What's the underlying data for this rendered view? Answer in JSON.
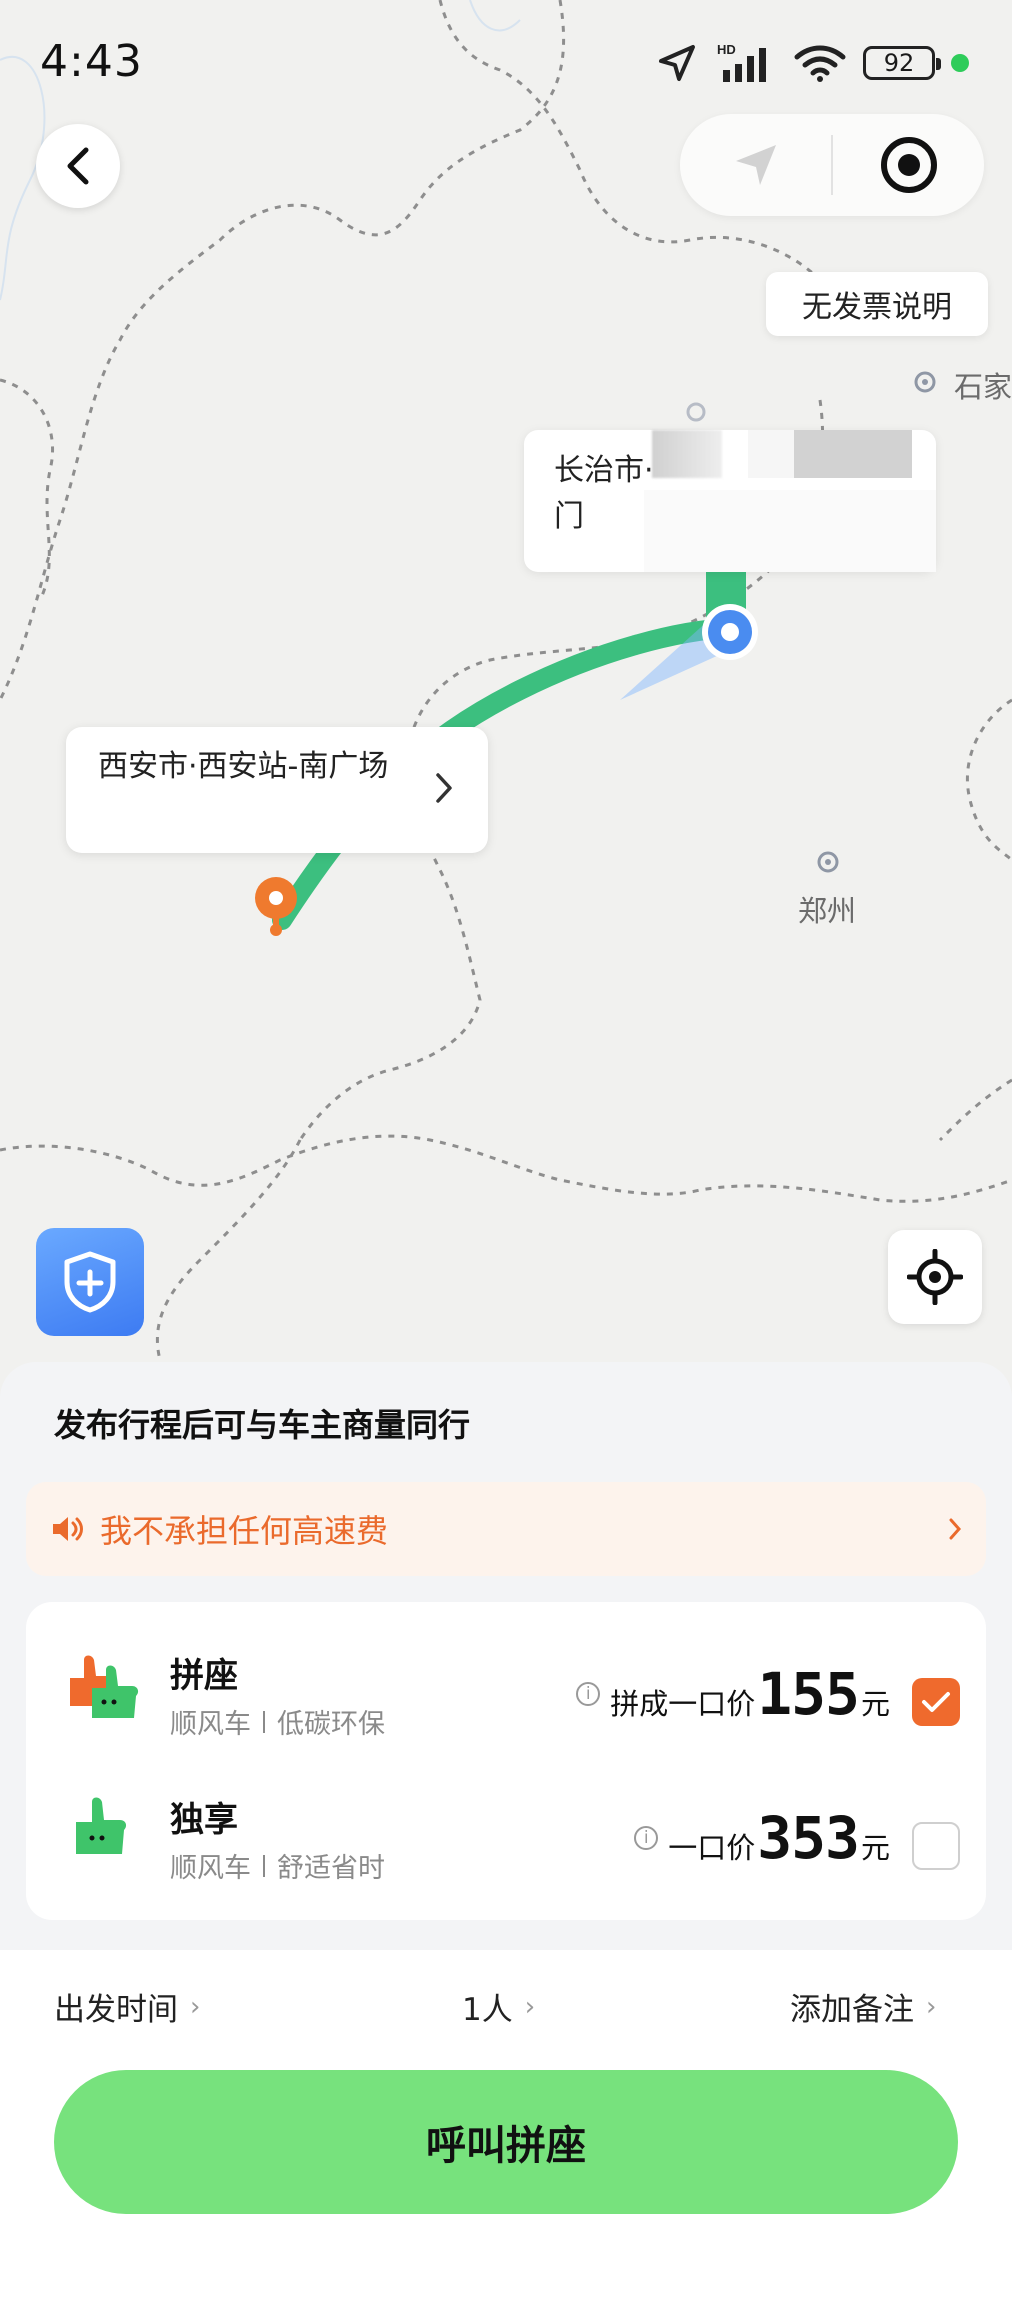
{
  "status_bar": {
    "time": "4:43",
    "battery": "92",
    "network": "HD"
  },
  "map": {
    "invoice_button": "无发票说明",
    "city_labels": [
      "石家",
      "郑州"
    ],
    "destination_label": {
      "line1": "长治市·",
      "line2": "门"
    },
    "origin_label": {
      "text": "西安市·西安站-南广场"
    }
  },
  "sheet": {
    "title": "发布行程后可与车主商量同行",
    "notice": "我不承担任何高速费",
    "options": [
      {
        "name": "拼座",
        "tag1": "顺风车",
        "tag2": "低碳环保",
        "price_label": "拼成一口价",
        "price": "155",
        "unit": "元",
        "selected": true
      },
      {
        "name": "独享",
        "tag1": "顺风车",
        "tag2": "舒适省时",
        "price_label": "一口价",
        "price": "353",
        "unit": "元",
        "selected": false
      }
    ],
    "footer": {
      "depart_time": "出发时间",
      "passengers": "1人",
      "remark": "添加备注"
    },
    "call_button": "呼叫拼座"
  },
  "colors": {
    "accent_green": "#77e27d",
    "route_green": "#3cbf7f",
    "orange": "#ef6a2d",
    "notice_bg": "#fdf3ec"
  }
}
